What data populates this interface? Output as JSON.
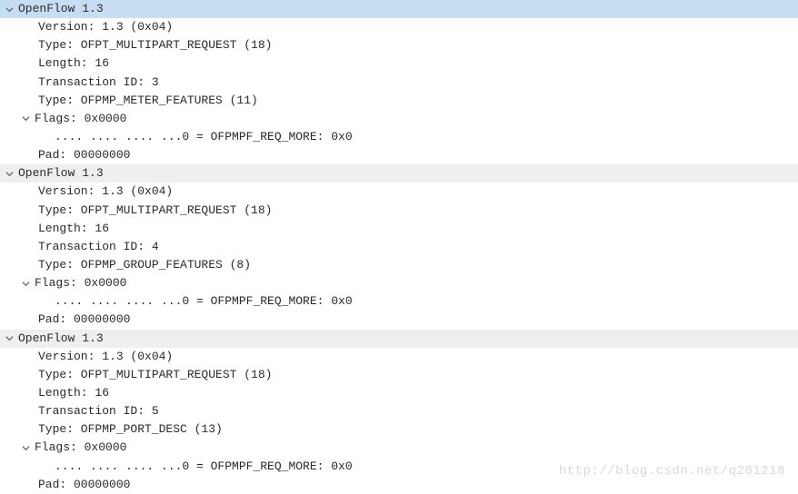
{
  "packets": [
    {
      "header": "OpenFlow 1.3",
      "highlighted": true,
      "fields": {
        "version": "Version: 1.3 (0x04)",
        "type1": "Type: OFPT_MULTIPART_REQUEST (18)",
        "length": "Length: 16",
        "txid": "Transaction ID: 3",
        "type2": "Type: OFPMP_METER_FEATURES (11)",
        "flags": "Flags: 0x0000",
        "flags_detail": ".... .... .... ...0 = OFPMPF_REQ_MORE: 0x0",
        "pad": "Pad: 00000000"
      }
    },
    {
      "header": "OpenFlow 1.3",
      "highlighted": false,
      "fields": {
        "version": "Version: 1.3 (0x04)",
        "type1": "Type: OFPT_MULTIPART_REQUEST (18)",
        "length": "Length: 16",
        "txid": "Transaction ID: 4",
        "type2": "Type: OFPMP_GROUP_FEATURES (8)",
        "flags": "Flags: 0x0000",
        "flags_detail": ".... .... .... ...0 = OFPMPF_REQ_MORE: 0x0",
        "pad": "Pad: 00000000"
      }
    },
    {
      "header": "OpenFlow 1.3",
      "highlighted": false,
      "fields": {
        "version": "Version: 1.3 (0x04)",
        "type1": "Type: OFPT_MULTIPART_REQUEST (18)",
        "length": "Length: 16",
        "txid": "Transaction ID: 5",
        "type2": "Type: OFPMP_PORT_DESC (13)",
        "flags": "Flags: 0x0000",
        "flags_detail": ".... .... .... ...0 = OFPMPF_REQ_MORE: 0x0",
        "pad": "Pad: 00000000"
      }
    }
  ],
  "watermark": "http://blog.csdn.net/q201218"
}
